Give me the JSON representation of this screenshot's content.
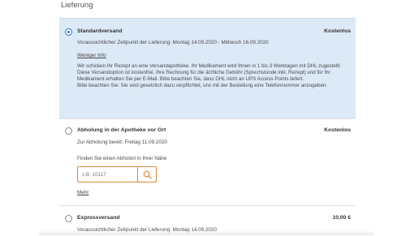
{
  "section": {
    "heading": "Lieferung"
  },
  "options": [
    {
      "title": "Standardversand",
      "price": "Kostenlos",
      "selected": true,
      "delivery_text": "Voraussichtlicher Zeitpunkt der Lieferung: Montag 14.09.2020 - Mittwoch 16.09.2020",
      "toggle_link": "Weniger Info",
      "description_1": "Wir schicken Ihr Rezept an eine Versandapotheke. Ihr Medikament wird Ihnen in 1 bis 3 Werktagen mit DHL zugestellt. Diese Versandoption ist kostenfrei. Ihre Rechnung für die ärztliche Gebühr (Sprechstunde inkl. Rezept) und für Ihr Medikament erhalten Sie per E-Mail. Bitte beachten Sie, dass DHL nicht an UPS Access Points liefert.",
      "description_2": "Bitte beachten Sie: Sie sind gesetzlich dazu verpflichtet, uns mit der Bestellung eine Telefonnummer anzugeben."
    },
    {
      "title": "Abholung in der Apotheke vor Ort",
      "price": "Kostenlos",
      "selected": false,
      "pickup_text": "Zur Abholung bereit: Freitag 11.09.2020",
      "search_label": "Finden Sie einen Abholort in Ihrer Nähe",
      "search_placeholder": "z.B. 10117",
      "search_value": "",
      "more_link": "Mehr"
    },
    {
      "title": "Expressversand",
      "price": "10,00 €",
      "selected": false,
      "delivery_text": "Voraussichtlicher Zeitpunkt der Lieferung: Montag 14.09.2020"
    }
  ],
  "colors": {
    "selected_bg": "#dce9f7",
    "radio_accent": "#2d6ad6",
    "search_border": "#d98a3c"
  },
  "icons": {
    "search_button": "search-icon"
  }
}
